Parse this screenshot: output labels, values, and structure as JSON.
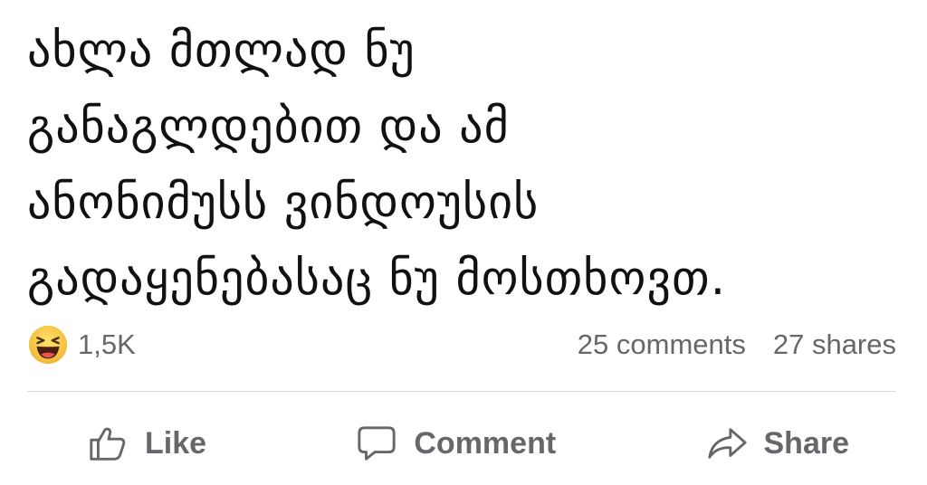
{
  "post": {
    "lines": [
      "ახლა მთლად ნუ",
      "განაგლდებით და ამ",
      "ანონიმუსს ვინდოუსის",
      "გადაყენებასაც ნუ მოსთხოვთ."
    ]
  },
  "stats": {
    "reaction_icon": "laughing-face-icon",
    "reaction_count": "1,5K",
    "comments": "25 comments",
    "shares": "27 shares"
  },
  "actions": {
    "like": {
      "label": "Like",
      "icon": "thumbs-up-icon"
    },
    "comment": {
      "label": "Comment",
      "icon": "speech-bubble-icon"
    },
    "share": {
      "label": "Share",
      "icon": "share-arrow-icon"
    }
  },
  "colors": {
    "text": "#111111",
    "secondary_text": "#65676b",
    "divider": "#d6d8dc",
    "emoji_yellow": "#f7c93c"
  }
}
